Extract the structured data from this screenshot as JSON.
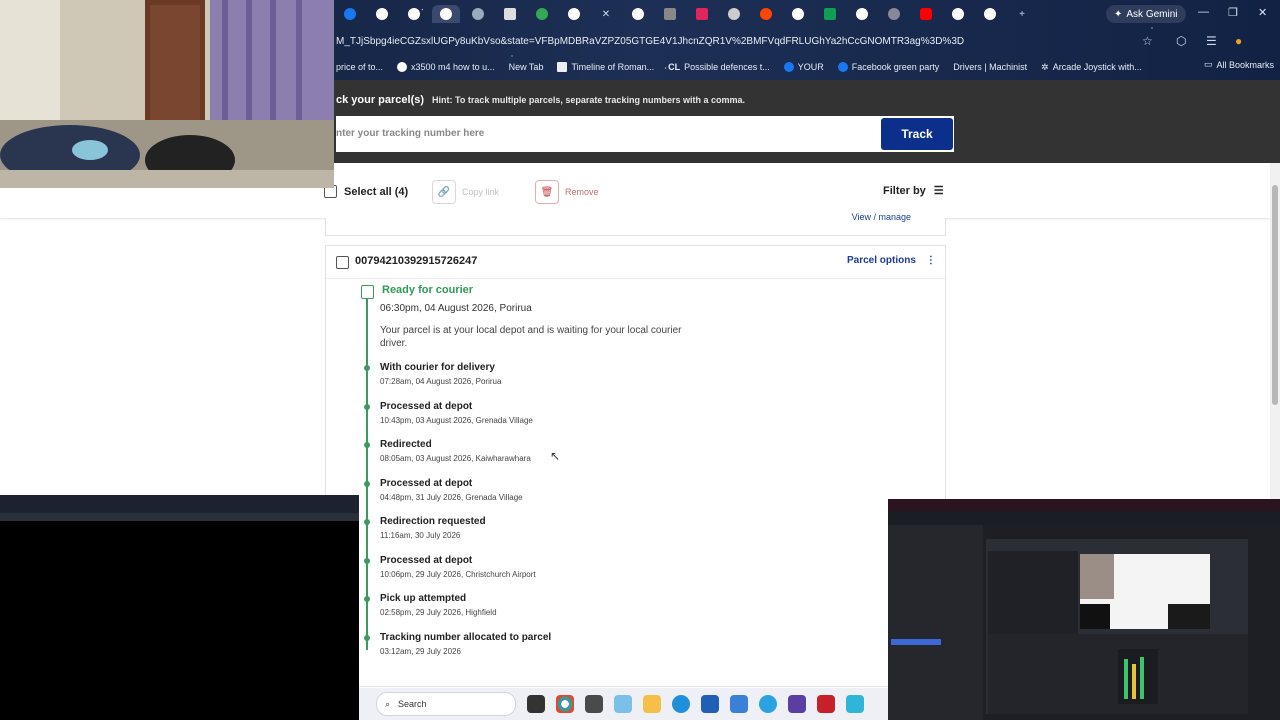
{
  "browser": {
    "ask_gemini": "Ask Gemini",
    "url": "M_TJjSbpg4ieCGZsxlUGPy8uKbVso&state=VFBpMDBRaVZPZ05GTGE4V1JhcnZQR1V%2BMFVqdFRLUGhYa2hCcGNOMTR3ag%3D%3D",
    "bookmarks": [
      "price of to...",
      "x3500 m4 how to u...",
      "New Tab",
      "Timeline of Roman...",
      "Possible defences t...",
      "YOUR",
      "Facebook green party",
      "Drivers | Machinist",
      "Arcade Joystick with..."
    ],
    "all_bookmarks": "All Bookmarks"
  },
  "tracker": {
    "heading": "ck your parcel(s)",
    "hint": "Hint: To track multiple parcels, separate tracking numbers with a comma.",
    "input_placeholder": "nter your tracking number here",
    "track_button": "Track"
  },
  "toolbar": {
    "select_all": "Select all (4)",
    "copy_link": "Copy link",
    "remove": "Remove",
    "filter_by": "Filter by"
  },
  "previous_card": {
    "view_manage": "View / manage"
  },
  "parcel": {
    "tracking_number": "00794210392915726247",
    "options_label": "Parcel options",
    "current_status": "Ready for courier",
    "current_time": "06:30pm, 04 August 2026, Porirua",
    "current_description": "Your parcel is at your local depot and is waiting for your local courier driver.",
    "events": [
      {
        "title": "With courier for delivery",
        "detail": "07:28am, 04 August 2026, Porirua"
      },
      {
        "title": "Processed at depot",
        "detail": "10:43pm, 03 August 2026, Grenada Village"
      },
      {
        "title": "Redirected",
        "detail": "08:05am, 03 August 2026, Kaiwharawhara"
      },
      {
        "title": "Processed at depot",
        "detail": "04:48pm, 31 July 2026, Grenada Village"
      },
      {
        "title": "Redirection requested",
        "detail": "11:16am, 30 July 2026"
      },
      {
        "title": "Processed at depot",
        "detail": "10:06pm, 29 July 2026, Christchurch Airport"
      },
      {
        "title": "Pick up attempted",
        "detail": "02:58pm, 29 July 2026, Highfield"
      },
      {
        "title": "Tracking number allocated to parcel",
        "detail": "03:12am, 29 July 2026"
      }
    ]
  },
  "taskbar": {
    "search_label": "Search"
  },
  "colors": {
    "accent_blue": "#0d2f8c",
    "status_green": "#2f9a54",
    "header_dark": "#333333"
  }
}
